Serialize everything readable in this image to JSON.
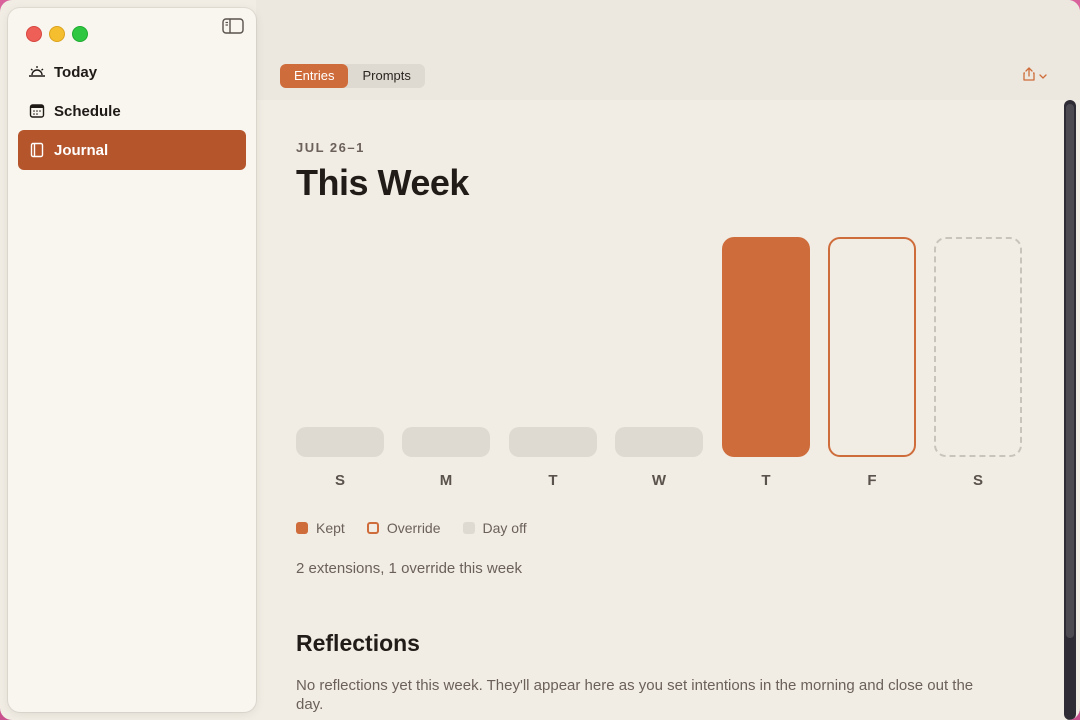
{
  "sidebar": {
    "items": [
      {
        "label": "Today",
        "icon": "sunrise-icon",
        "active": false
      },
      {
        "label": "Schedule",
        "icon": "calendar-icon",
        "active": false
      },
      {
        "label": "Journal",
        "icon": "book-icon",
        "active": true
      }
    ]
  },
  "toolbar": {
    "tabs": [
      {
        "label": "Entries",
        "active": true
      },
      {
        "label": "Prompts",
        "active": false
      }
    ],
    "share_icon": "share-icon"
  },
  "week": {
    "range": "JUL 26–1",
    "title": "This Week",
    "days": [
      {
        "label": "S",
        "status": "none"
      },
      {
        "label": "M",
        "status": "none"
      },
      {
        "label": "T",
        "status": "none"
      },
      {
        "label": "W",
        "status": "none"
      },
      {
        "label": "T",
        "status": "kept"
      },
      {
        "label": "F",
        "status": "override"
      },
      {
        "label": "S",
        "status": "dayoff"
      }
    ],
    "legend": [
      {
        "label": "Kept",
        "style": "kept"
      },
      {
        "label": "Override",
        "style": "override"
      },
      {
        "label": "Day off",
        "style": "dayoff"
      }
    ],
    "summary": "2 extensions, 1 override this week"
  },
  "reflections": {
    "title": "Reflections",
    "empty_text": "No reflections yet this week. They'll appear here as you set intentions in the morning and close out the day."
  },
  "colors": {
    "accent": "#cf6c3b",
    "sidebar_active": "#b5552b",
    "placeholder_bar": "#dedad2",
    "dayoff_border": "#c9c4bb"
  }
}
